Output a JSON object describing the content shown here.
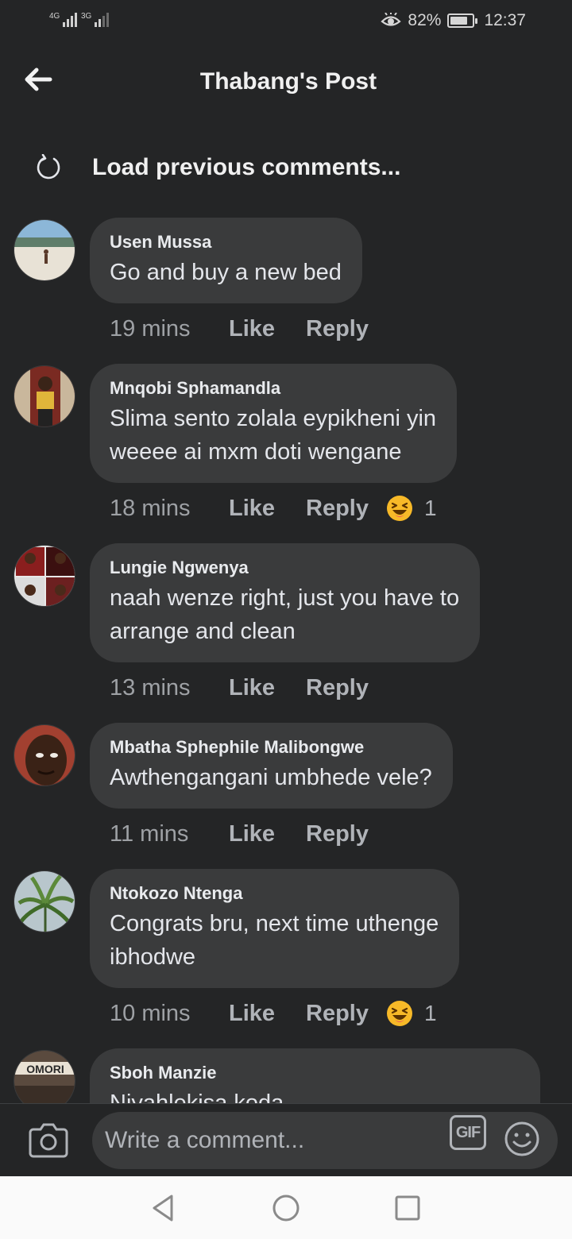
{
  "status_bar": {
    "network_1": "4G",
    "network_2": "3G",
    "battery_percent": "82%",
    "battery_level": 0.82,
    "time": "12:37"
  },
  "header": {
    "title": "Thabang's Post"
  },
  "load_previous": {
    "label": "Load previous comments..."
  },
  "comments": [
    {
      "author": "Usen Mussa",
      "text": "Go and buy a new bed",
      "time": "19 mins",
      "like": "Like",
      "reply": "Reply",
      "reaction": null,
      "reaction_count": null
    },
    {
      "author": "Mnqobi Sphamandla",
      "text": "Slima sento zolala eypikheni yin\nweeee ai mxm doti wengane",
      "time": "18 mins",
      "like": "Like",
      "reply": "Reply",
      "reaction": "laughing-emoji",
      "reaction_count": "1"
    },
    {
      "author": "Lungie Ngwenya",
      "text": "naah wenze right,  just you have to\narrange and clean",
      "time": "13 mins",
      "like": "Like",
      "reply": "Reply",
      "reaction": null,
      "reaction_count": null
    },
    {
      "author": "Mbatha Sphephile Malibongwe",
      "text": "Awthengangani umbhede vele?",
      "time": "11 mins",
      "like": "Like",
      "reply": "Reply",
      "reaction": null,
      "reaction_count": null
    },
    {
      "author": "Ntokozo Ntenga",
      "text": "Congrats bru, next time uthenge\nibhodwe",
      "time": "10 mins",
      "like": "Like",
      "reply": "Reply",
      "reaction": "laughing-emoji",
      "reaction_count": "1"
    },
    {
      "author": "Sboh Manzie",
      "text": "Niyahlekisa koda",
      "time": "",
      "like": "",
      "reply": "",
      "reaction": null,
      "reaction_count": null
    }
  ],
  "composer": {
    "placeholder": "Write a comment...",
    "gif_label": "GIF"
  },
  "icons": {
    "back": "arrow-left-icon",
    "load": "refresh-icon",
    "camera": "camera-icon",
    "emoji": "smiley-icon",
    "nav_back": "triangle-back-icon",
    "nav_home": "circle-home-icon",
    "nav_recents": "square-recents-icon"
  },
  "colors": {
    "background": "#242526",
    "bubble": "#3a3b3c",
    "text": "#e4e6eb",
    "muted": "#b0b3b8",
    "reaction": "#f7b928"
  }
}
